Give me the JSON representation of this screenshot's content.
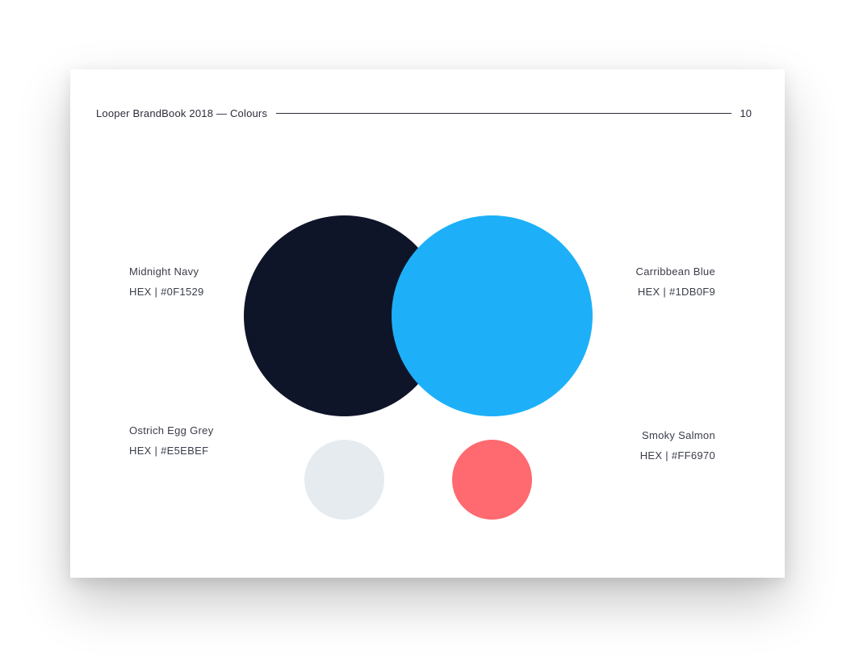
{
  "header": {
    "title": "Looper BrandBook 2018 — Colours",
    "page_number": "10"
  },
  "colours": {
    "navy": {
      "name": "Midnight Navy",
      "hex_label": "HEX | #0F1529",
      "color": "#0F1529"
    },
    "blue": {
      "name": "Carribbean Blue",
      "hex_label": "HEX | #1DB0F9",
      "color": "#1DB0F9"
    },
    "grey": {
      "name": "Ostrich Egg Grey",
      "hex_label": "HEX | #E5EBEF",
      "color": "#E5EBEF"
    },
    "salmon": {
      "name": "Smoky Salmon",
      "hex_label": "HEX | #FF6970",
      "color": "#FF6970"
    }
  }
}
